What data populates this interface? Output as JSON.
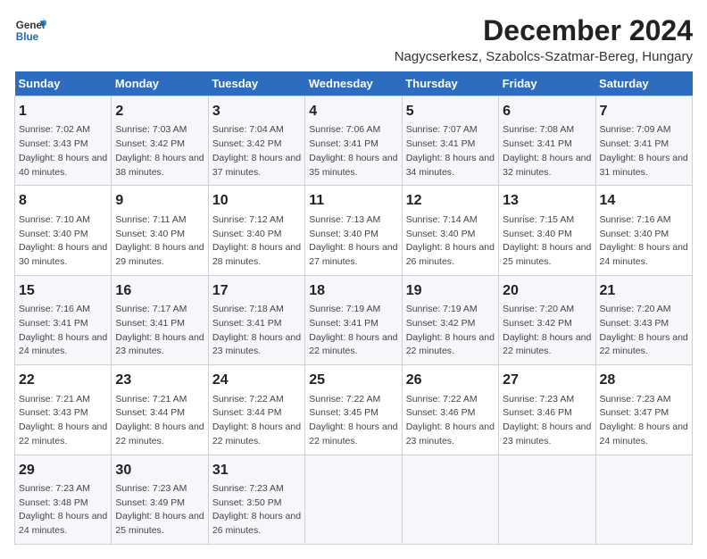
{
  "logo": {
    "line1": "General",
    "line2": "Blue"
  },
  "title": "December 2024",
  "subtitle": "Nagycserkesz, Szabolcs-Szatmar-Bereg, Hungary",
  "weekdays": [
    "Sunday",
    "Monday",
    "Tuesday",
    "Wednesday",
    "Thursday",
    "Friday",
    "Saturday"
  ],
  "weeks": [
    [
      {
        "day": "1",
        "sunrise": "Sunrise: 7:02 AM",
        "sunset": "Sunset: 3:43 PM",
        "daylight": "Daylight: 8 hours and 40 minutes."
      },
      {
        "day": "2",
        "sunrise": "Sunrise: 7:03 AM",
        "sunset": "Sunset: 3:42 PM",
        "daylight": "Daylight: 8 hours and 38 minutes."
      },
      {
        "day": "3",
        "sunrise": "Sunrise: 7:04 AM",
        "sunset": "Sunset: 3:42 PM",
        "daylight": "Daylight: 8 hours and 37 minutes."
      },
      {
        "day": "4",
        "sunrise": "Sunrise: 7:06 AM",
        "sunset": "Sunset: 3:41 PM",
        "daylight": "Daylight: 8 hours and 35 minutes."
      },
      {
        "day": "5",
        "sunrise": "Sunrise: 7:07 AM",
        "sunset": "Sunset: 3:41 PM",
        "daylight": "Daylight: 8 hours and 34 minutes."
      },
      {
        "day": "6",
        "sunrise": "Sunrise: 7:08 AM",
        "sunset": "Sunset: 3:41 PM",
        "daylight": "Daylight: 8 hours and 32 minutes."
      },
      {
        "day": "7",
        "sunrise": "Sunrise: 7:09 AM",
        "sunset": "Sunset: 3:41 PM",
        "daylight": "Daylight: 8 hours and 31 minutes."
      }
    ],
    [
      {
        "day": "8",
        "sunrise": "Sunrise: 7:10 AM",
        "sunset": "Sunset: 3:40 PM",
        "daylight": "Daylight: 8 hours and 30 minutes."
      },
      {
        "day": "9",
        "sunrise": "Sunrise: 7:11 AM",
        "sunset": "Sunset: 3:40 PM",
        "daylight": "Daylight: 8 hours and 29 minutes."
      },
      {
        "day": "10",
        "sunrise": "Sunrise: 7:12 AM",
        "sunset": "Sunset: 3:40 PM",
        "daylight": "Daylight: 8 hours and 28 minutes."
      },
      {
        "day": "11",
        "sunrise": "Sunrise: 7:13 AM",
        "sunset": "Sunset: 3:40 PM",
        "daylight": "Daylight: 8 hours and 27 minutes."
      },
      {
        "day": "12",
        "sunrise": "Sunrise: 7:14 AM",
        "sunset": "Sunset: 3:40 PM",
        "daylight": "Daylight: 8 hours and 26 minutes."
      },
      {
        "day": "13",
        "sunrise": "Sunrise: 7:15 AM",
        "sunset": "Sunset: 3:40 PM",
        "daylight": "Daylight: 8 hours and 25 minutes."
      },
      {
        "day": "14",
        "sunrise": "Sunrise: 7:16 AM",
        "sunset": "Sunset: 3:40 PM",
        "daylight": "Daylight: 8 hours and 24 minutes."
      }
    ],
    [
      {
        "day": "15",
        "sunrise": "Sunrise: 7:16 AM",
        "sunset": "Sunset: 3:41 PM",
        "daylight": "Daylight: 8 hours and 24 minutes."
      },
      {
        "day": "16",
        "sunrise": "Sunrise: 7:17 AM",
        "sunset": "Sunset: 3:41 PM",
        "daylight": "Daylight: 8 hours and 23 minutes."
      },
      {
        "day": "17",
        "sunrise": "Sunrise: 7:18 AM",
        "sunset": "Sunset: 3:41 PM",
        "daylight": "Daylight: 8 hours and 23 minutes."
      },
      {
        "day": "18",
        "sunrise": "Sunrise: 7:19 AM",
        "sunset": "Sunset: 3:41 PM",
        "daylight": "Daylight: 8 hours and 22 minutes."
      },
      {
        "day": "19",
        "sunrise": "Sunrise: 7:19 AM",
        "sunset": "Sunset: 3:42 PM",
        "daylight": "Daylight: 8 hours and 22 minutes."
      },
      {
        "day": "20",
        "sunrise": "Sunrise: 7:20 AM",
        "sunset": "Sunset: 3:42 PM",
        "daylight": "Daylight: 8 hours and 22 minutes."
      },
      {
        "day": "21",
        "sunrise": "Sunrise: 7:20 AM",
        "sunset": "Sunset: 3:43 PM",
        "daylight": "Daylight: 8 hours and 22 minutes."
      }
    ],
    [
      {
        "day": "22",
        "sunrise": "Sunrise: 7:21 AM",
        "sunset": "Sunset: 3:43 PM",
        "daylight": "Daylight: 8 hours and 22 minutes."
      },
      {
        "day": "23",
        "sunrise": "Sunrise: 7:21 AM",
        "sunset": "Sunset: 3:44 PM",
        "daylight": "Daylight: 8 hours and 22 minutes."
      },
      {
        "day": "24",
        "sunrise": "Sunrise: 7:22 AM",
        "sunset": "Sunset: 3:44 PM",
        "daylight": "Daylight: 8 hours and 22 minutes."
      },
      {
        "day": "25",
        "sunrise": "Sunrise: 7:22 AM",
        "sunset": "Sunset: 3:45 PM",
        "daylight": "Daylight: 8 hours and 22 minutes."
      },
      {
        "day": "26",
        "sunrise": "Sunrise: 7:22 AM",
        "sunset": "Sunset: 3:46 PM",
        "daylight": "Daylight: 8 hours and 23 minutes."
      },
      {
        "day": "27",
        "sunrise": "Sunrise: 7:23 AM",
        "sunset": "Sunset: 3:46 PM",
        "daylight": "Daylight: 8 hours and 23 minutes."
      },
      {
        "day": "28",
        "sunrise": "Sunrise: 7:23 AM",
        "sunset": "Sunset: 3:47 PM",
        "daylight": "Daylight: 8 hours and 24 minutes."
      }
    ],
    [
      {
        "day": "29",
        "sunrise": "Sunrise: 7:23 AM",
        "sunset": "Sunset: 3:48 PM",
        "daylight": "Daylight: 8 hours and 24 minutes."
      },
      {
        "day": "30",
        "sunrise": "Sunrise: 7:23 AM",
        "sunset": "Sunset: 3:49 PM",
        "daylight": "Daylight: 8 hours and 25 minutes."
      },
      {
        "day": "31",
        "sunrise": "Sunrise: 7:23 AM",
        "sunset": "Sunset: 3:50 PM",
        "daylight": "Daylight: 8 hours and 26 minutes."
      },
      null,
      null,
      null,
      null
    ]
  ]
}
